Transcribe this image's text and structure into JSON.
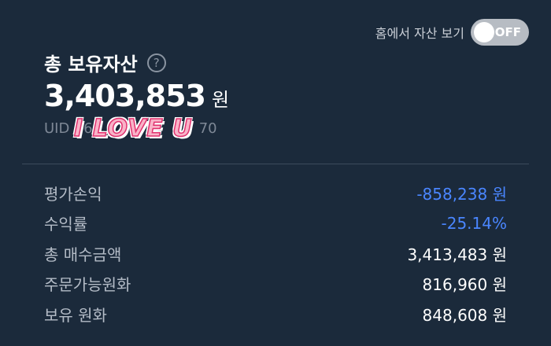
{
  "header": {
    "toggle_label": "홈에서 자산 보기",
    "toggle_state": "OFF"
  },
  "summary": {
    "title": "총 보유자산",
    "help_icon": "?",
    "total_value": "3,403,853",
    "total_unit": "원",
    "uid_label": "UID",
    "uid_visible_start": "64",
    "uid_visible_end": "70"
  },
  "sticker": {
    "text": "I LOVE U"
  },
  "details": [
    {
      "label": "평가손익",
      "value": "-858,238 원",
      "negative": true
    },
    {
      "label": "수익률",
      "value": "-25.14%",
      "negative": true
    },
    {
      "label": "총 매수금액",
      "value": "3,413,483 원",
      "negative": false
    },
    {
      "label": "주문가능원화",
      "value": "816,960 원",
      "negative": false
    },
    {
      "label": "보유 원화",
      "value": "848,608 원",
      "negative": false
    }
  ],
  "colors": {
    "background": "#1b2a3b",
    "negative": "#4a86ff",
    "toggle_off": "#b7bcc3"
  }
}
